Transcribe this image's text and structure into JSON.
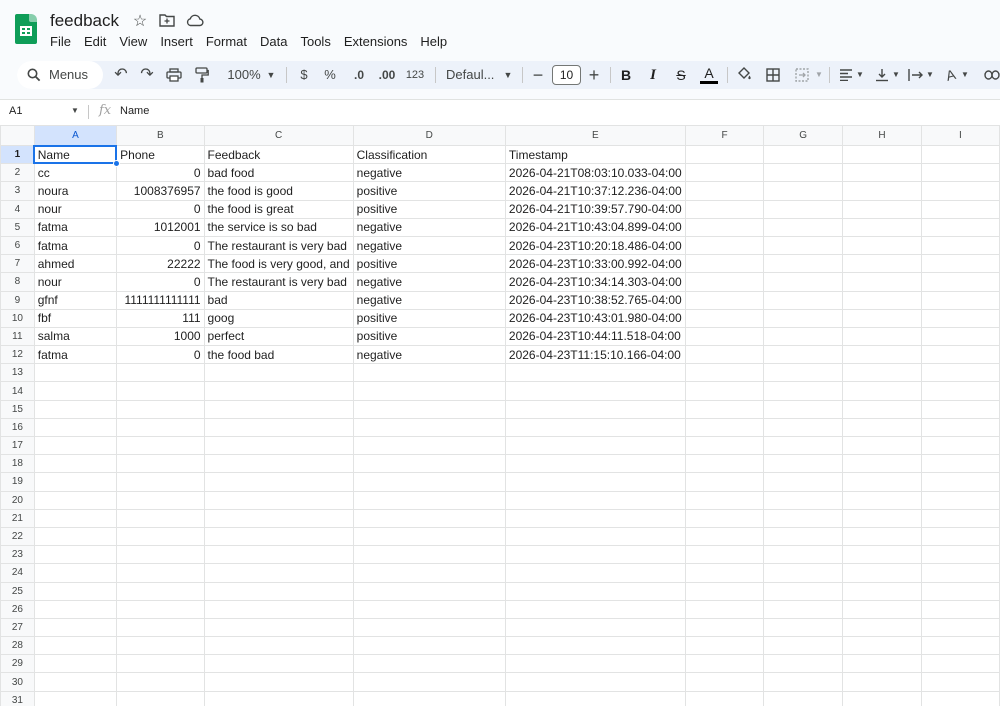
{
  "doc": {
    "title": "feedback",
    "icons": [
      "star-icon",
      "move-to-folder-icon",
      "cloud-status-icon"
    ]
  },
  "menu": [
    "File",
    "Edit",
    "View",
    "Insert",
    "Format",
    "Data",
    "Tools",
    "Extensions",
    "Help"
  ],
  "toolbar": {
    "search_label": "Menus",
    "zoom": "100%",
    "currency": "$",
    "percent": "%",
    "decrease_decimal": ".0",
    "increase_decimal": ".00",
    "number_format": "123",
    "font": "Defaul...",
    "font_size": "10",
    "bold": "B",
    "italic": "I",
    "strikethrough": "S",
    "text_color": "A"
  },
  "formula_bar": {
    "cell_ref": "A1",
    "fx": "fx",
    "value": "Name"
  },
  "grid": {
    "columns": [
      "A",
      "B",
      "C",
      "D",
      "E",
      "F",
      "G",
      "H",
      "I"
    ],
    "row_count": 31,
    "selected_cell": "A1",
    "rows": [
      [
        "Name",
        "Phone",
        "Feedback",
        "Classification",
        "Timestamp"
      ],
      [
        "cc",
        "0",
        "bad food",
        "negative",
        "2026-04-21T08:03:10.033-04:00"
      ],
      [
        "noura",
        "1008376957",
        "the food is good",
        "positive",
        "2026-04-21T10:37:12.236-04:00"
      ],
      [
        "nour",
        "0",
        "the food is great",
        "positive",
        "2026-04-21T10:39:57.790-04:00"
      ],
      [
        "fatma",
        "1012001",
        "the service is so bad",
        "negative",
        "2026-04-21T10:43:04.899-04:00"
      ],
      [
        "fatma",
        "0",
        "The restaurant is very bad",
        "negative",
        "2026-04-23T10:20:18.486-04:00"
      ],
      [
        "ahmed",
        "22222",
        "The food is very good, and",
        "positive",
        "2026-04-23T10:33:00.992-04:00"
      ],
      [
        "nour",
        "0",
        "The restaurant is very bad",
        "negative",
        "2026-04-23T10:34:14.303-04:00"
      ],
      [
        "gfnf",
        "1111111111111",
        "bad",
        "negative",
        "2026-04-23T10:38:52.765-04:00"
      ],
      [
        "fbf",
        "111",
        "goog",
        "positive",
        "2026-04-23T10:43:01.980-04:00"
      ],
      [
        "salma",
        "1000",
        "perfect",
        "positive",
        "2026-04-23T10:44:11.518-04:00"
      ],
      [
        "fatma",
        "0",
        "the food bad",
        "negative",
        "2026-04-23T11:15:10.166-04:00"
      ]
    ]
  },
  "colors": {
    "accent": "#1a73e8",
    "header_selected": "#d3e3fd",
    "toolbar_bg": "#edf2fa",
    "sheets_green": "#0f9d58"
  }
}
